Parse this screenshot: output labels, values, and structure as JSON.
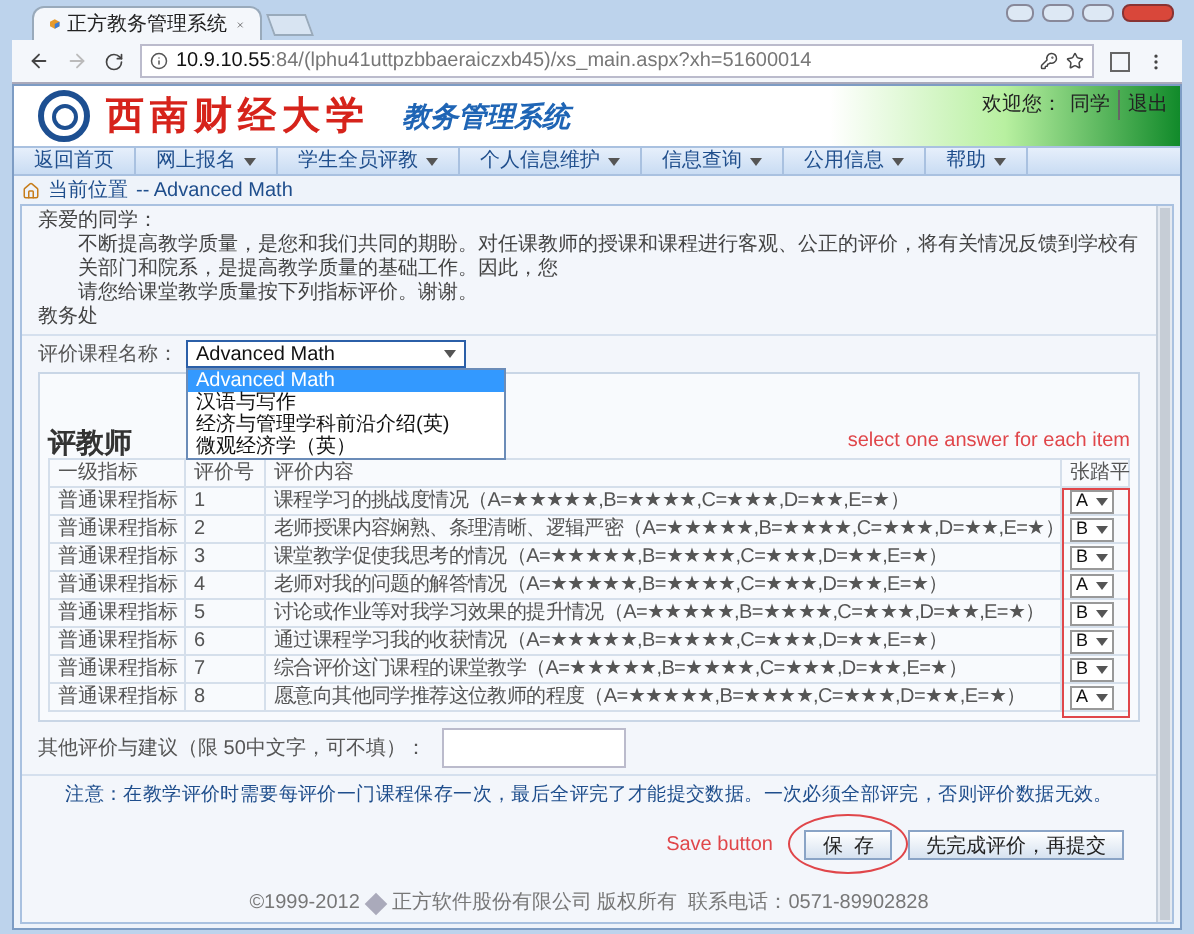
{
  "browser": {
    "tab_title": "正方教务管理系统",
    "url_host": "10.9.10.55",
    "url_rest": ":84/(lphu41uttpzbbaeraiczxb45)/xs_main.aspx?xh=51600014"
  },
  "header": {
    "school_name": "西南财经大学",
    "system_name": "教务管理系统",
    "welcome": "欢迎您：",
    "user": "同学",
    "logout": "退出"
  },
  "nav": [
    {
      "label": "返回首页",
      "has_menu": false
    },
    {
      "label": "网上报名",
      "has_menu": true
    },
    {
      "label": "学生全员评教",
      "has_menu": true
    },
    {
      "label": "个人信息维护",
      "has_menu": true
    },
    {
      "label": "信息查询",
      "has_menu": true
    },
    {
      "label": "公用信息",
      "has_menu": true
    },
    {
      "label": "帮助",
      "has_menu": true
    }
  ],
  "breadcrumb": {
    "label": "当前位置",
    "page": "-- Advanced Math"
  },
  "intro": {
    "greeting": "亲爱的同学：",
    "lines": [
      "不断提高教学质量，是您和我们共同的期盼。对任课教师的授课和课程进行客观、公正的评价，将有关情况反馈到学校有关部门和院系，是提高教学质量的基础工作。因此，您",
      "请您给课堂教学质量按下列指标评价。谢谢。"
    ],
    "signature": "教务处"
  },
  "course_select": {
    "label": "评价课程名称：",
    "value": "Advanced Math",
    "expanded": true,
    "options": [
      {
        "label": "Advanced Math",
        "selected": true
      },
      {
        "label": "汉语与写作",
        "selected": false
      },
      {
        "label": "经济与管理学科前沿介绍(英)",
        "selected": false
      },
      {
        "label": "微观经济学（英）",
        "selected": false
      }
    ]
  },
  "evaluation": {
    "title": "评教师",
    "columns": [
      "一级指标",
      "评价号",
      "评价内容",
      "张踏平"
    ],
    "rows": [
      {
        "category": "普通课程指标",
        "number": "1",
        "content": "课程学习的挑战度情况（A=★★★★★,B=★★★★,C=★★★,D=★★,E=★）",
        "answer": "A"
      },
      {
        "category": "普通课程指标",
        "number": "2",
        "content": "老师授课内容娴熟、条理清晰、逻辑严密（A=★★★★★,B=★★★★,C=★★★,D=★★,E=★）",
        "answer": "B"
      },
      {
        "category": "普通课程指标",
        "number": "3",
        "content": "课堂教学促使我思考的情况（A=★★★★★,B=★★★★,C=★★★,D=★★,E=★）",
        "answer": "B"
      },
      {
        "category": "普通课程指标",
        "number": "4",
        "content": "老师对我的问题的解答情况（A=★★★★★,B=★★★★,C=★★★,D=★★,E=★）",
        "answer": "A"
      },
      {
        "category": "普通课程指标",
        "number": "5",
        "content": "讨论或作业等对我学习效果的提升情况（A=★★★★★,B=★★★★,C=★★★,D=★★,E=★）",
        "answer": "B"
      },
      {
        "category": "普通课程指标",
        "number": "6",
        "content": "通过课程学习我的收获情况（A=★★★★★,B=★★★★,C=★★★,D=★★,E=★）",
        "answer": "B"
      },
      {
        "category": "普通课程指标",
        "number": "7",
        "content": "综合评价这门课程的课堂教学（A=★★★★★,B=★★★★,C=★★★,D=★★,E=★）",
        "answer": "B"
      },
      {
        "category": "普通课程指标",
        "number": "8",
        "content": "愿意向其他同学推荐这位教师的程度（A=★★★★★,B=★★★★,C=★★★,D=★★,E=★）",
        "answer": "A"
      }
    ]
  },
  "comment": {
    "label": "其他评价与建议（限 50中文字，可不填）："
  },
  "note": "注意：在教学评价时需要每评价一门课程保存一次，最后全评完了才能提交数据。一次必须全部评完，否则评价数据无效。",
  "buttons": [
    {
      "label": "保  存",
      "kind": "save"
    },
    {
      "label": "先完成评价，再提交",
      "kind": "submit"
    }
  ],
  "footer": {
    "copyright": "©1999-2012",
    "company": "正方软件股份有限公司 版权所有  联系电话：0571-89902828"
  },
  "annotations": [
    {
      "text": "select one answer for each item",
      "kind": "box"
    },
    {
      "text": "Save button",
      "kind": "ellipse"
    }
  ]
}
